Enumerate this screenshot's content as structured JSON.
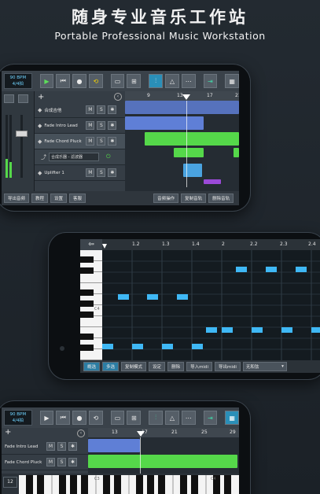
{
  "header": {
    "title_cn": "随身专业音乐工作站",
    "title_en": "Portable Professional Music Workstation"
  },
  "colors": {
    "accent_blue": "#3fb8f5",
    "clip_blue": "#5f7fd6",
    "clip_green": "#55d84a",
    "play_green": "#5dde5a",
    "loop_yellow": "#f5d200"
  },
  "transport": {
    "bpm_label": "90 BPM",
    "time_sig": "4/4拍",
    "icons": [
      "play-icon",
      "rewind-icon",
      "record-icon",
      "loop-icon",
      "folder-icon",
      "grid-icon",
      "mixer-icon",
      "metronome-icon",
      "pattern-icon",
      "marker-icon",
      "keyboard-icon"
    ]
  },
  "arranger": {
    "ruler": [
      "9",
      "13",
      "17",
      "21"
    ],
    "tracks": [
      {
        "name": "合成吉他",
        "m": "M",
        "s": "S"
      },
      {
        "name": "Fade Intro Lead",
        "m": "M",
        "s": "S"
      },
      {
        "name": "Fade Chord Pluck",
        "m": "M",
        "s": "S"
      },
      {
        "name": "合成乐器 - 滤波器",
        "m": "",
        "s": ""
      },
      {
        "name": "Uplifter 1",
        "m": "M",
        "s": "S"
      }
    ],
    "bottom_buttons": [
      "导出音频",
      "教程",
      "设置",
      "客服",
      "音频操作",
      "复制音轨",
      "删除音轨"
    ]
  },
  "piano_roll": {
    "ruler": [
      "1.2",
      "1.3",
      "1.4",
      "2",
      "2.2",
      "2.3",
      "2.4"
    ],
    "c_label": "C4",
    "bottom_buttons": [
      "概选",
      "多选",
      "复制模式",
      "设定",
      "删除",
      "导入midi",
      "导出midi"
    ],
    "dropdown_value": "无和弦"
  },
  "bottom_phone": {
    "bpm_label": "90 BPM",
    "time_sig": "4/4拍",
    "ruler": [
      "13",
      "17",
      "21",
      "25",
      "29"
    ],
    "tracks": [
      {
        "name": "Fade Intro Lead",
        "m": "M",
        "s": "S"
      },
      {
        "name": "Fade Chord Pluck",
        "m": "M",
        "s": "S"
      }
    ],
    "octave": "12",
    "key_labels": [
      "C3",
      "C4"
    ]
  }
}
